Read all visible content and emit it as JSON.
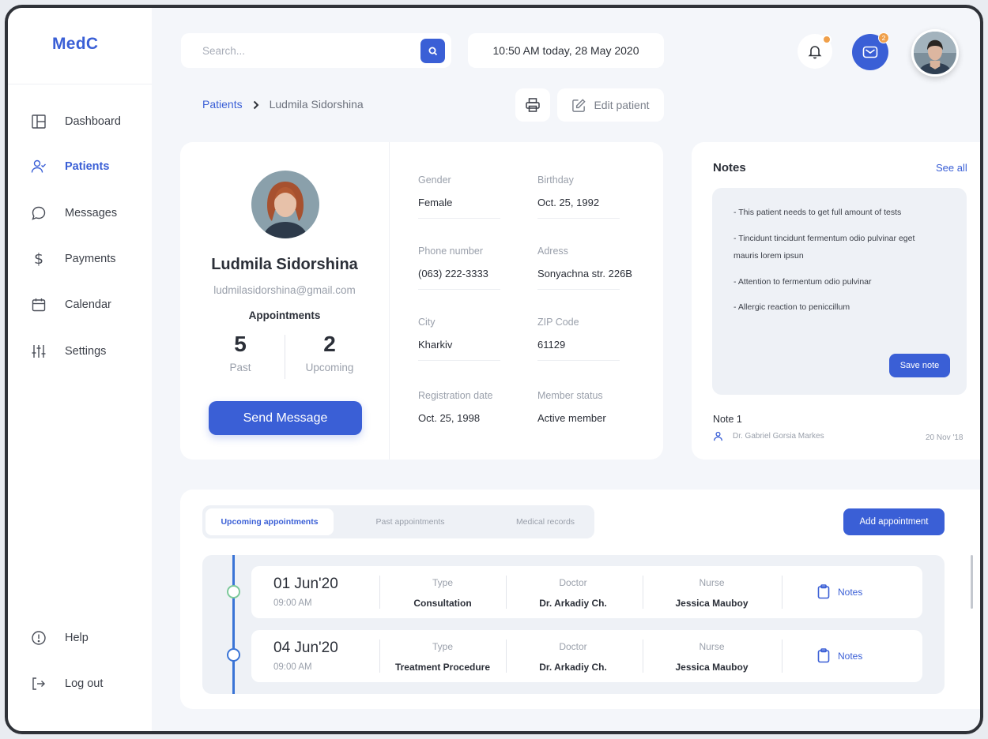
{
  "app": {
    "logo": "MedC"
  },
  "sidebar": {
    "items": [
      {
        "label": "Dashboard",
        "icon": "dashboard-icon",
        "active": false
      },
      {
        "label": "Patients",
        "icon": "patients-icon",
        "active": true
      },
      {
        "label": "Messages",
        "icon": "message-icon",
        "active": false
      },
      {
        "label": "Payments",
        "icon": "dollar-icon",
        "active": false
      },
      {
        "label": "Calendar",
        "icon": "calendar-icon",
        "active": false
      },
      {
        "label": "Settings",
        "icon": "sliders-icon",
        "active": false
      }
    ],
    "bottom": [
      {
        "label": "Help",
        "icon": "help-icon"
      },
      {
        "label": "Log out",
        "icon": "logout-icon"
      }
    ]
  },
  "topbar": {
    "search_placeholder": "Search...",
    "datetime": "10:50 AM today, 28 May 2020",
    "mail_badge": "2"
  },
  "breadcrumb": {
    "parent": "Patients",
    "current": "Ludmila Sidorshina"
  },
  "actions": {
    "edit_label": "Edit patient"
  },
  "patient": {
    "name": "Ludmila Sidorshina",
    "email": "ludmilasidorshina@gmail.com",
    "appointments_title": "Appointments",
    "past_count": "5",
    "past_label": "Past",
    "upcoming_count": "2",
    "upcoming_label": "Upcoming",
    "send_message": "Send Message",
    "fields": [
      {
        "label": "Gender",
        "value": "Female"
      },
      {
        "label": "Birthday",
        "value": "Oct. 25, 1992"
      },
      {
        "label": "Phone number",
        "value": "(063) 222-3333"
      },
      {
        "label": "Adress",
        "value": "Sonyachna str. 226B"
      },
      {
        "label": "City",
        "value": "Kharkiv"
      },
      {
        "label": "ZIP Code",
        "value": "61129"
      },
      {
        "label": "Registration date",
        "value": "Oct. 25, 1998"
      },
      {
        "label": "Member status",
        "value": "Active member"
      }
    ]
  },
  "notes": {
    "title": "Notes",
    "see_all": "See all",
    "lines": [
      "- This patient needs to get full amount of tests",
      "- Tincidunt tincidunt fermentum odio pulvinar eget mauris lorem ipsun",
      "- Attention to fermentum odio pulvinar",
      "- Allergic reaction to peniccillum"
    ],
    "save_label": "Save note",
    "saved": {
      "title": "Note 1",
      "doctor": "Dr. Gabriel Gorsia Markes",
      "date": "20 Nov '18"
    }
  },
  "appointments": {
    "tabs": [
      "Upcoming appointments",
      "Past appointments",
      "Medical records"
    ],
    "active_tab": 0,
    "add_label": "Add appointment",
    "labels": {
      "type": "Type",
      "doctor": "Doctor",
      "nurse": "Nurse",
      "notes": "Notes"
    },
    "rows": [
      {
        "date": "01 Jun'20",
        "time": "09:00 AM",
        "type": "Consultation",
        "doctor": "Dr. Arkadiy Ch.",
        "nurse": "Jessica Mauboy",
        "dot_color": "#7cc99a"
      },
      {
        "date": "04 Jun'20",
        "time": "09:00 AM",
        "type": "Treatment Procedure",
        "doctor": "Dr. Arkadiy Ch.",
        "nurse": "Jessica Mauboy",
        "dot_color": "#3a74d6"
      }
    ]
  },
  "colors": {
    "accent": "#3a5fd6",
    "badge": "#f0a04b",
    "surface": "#f4f6fa"
  }
}
